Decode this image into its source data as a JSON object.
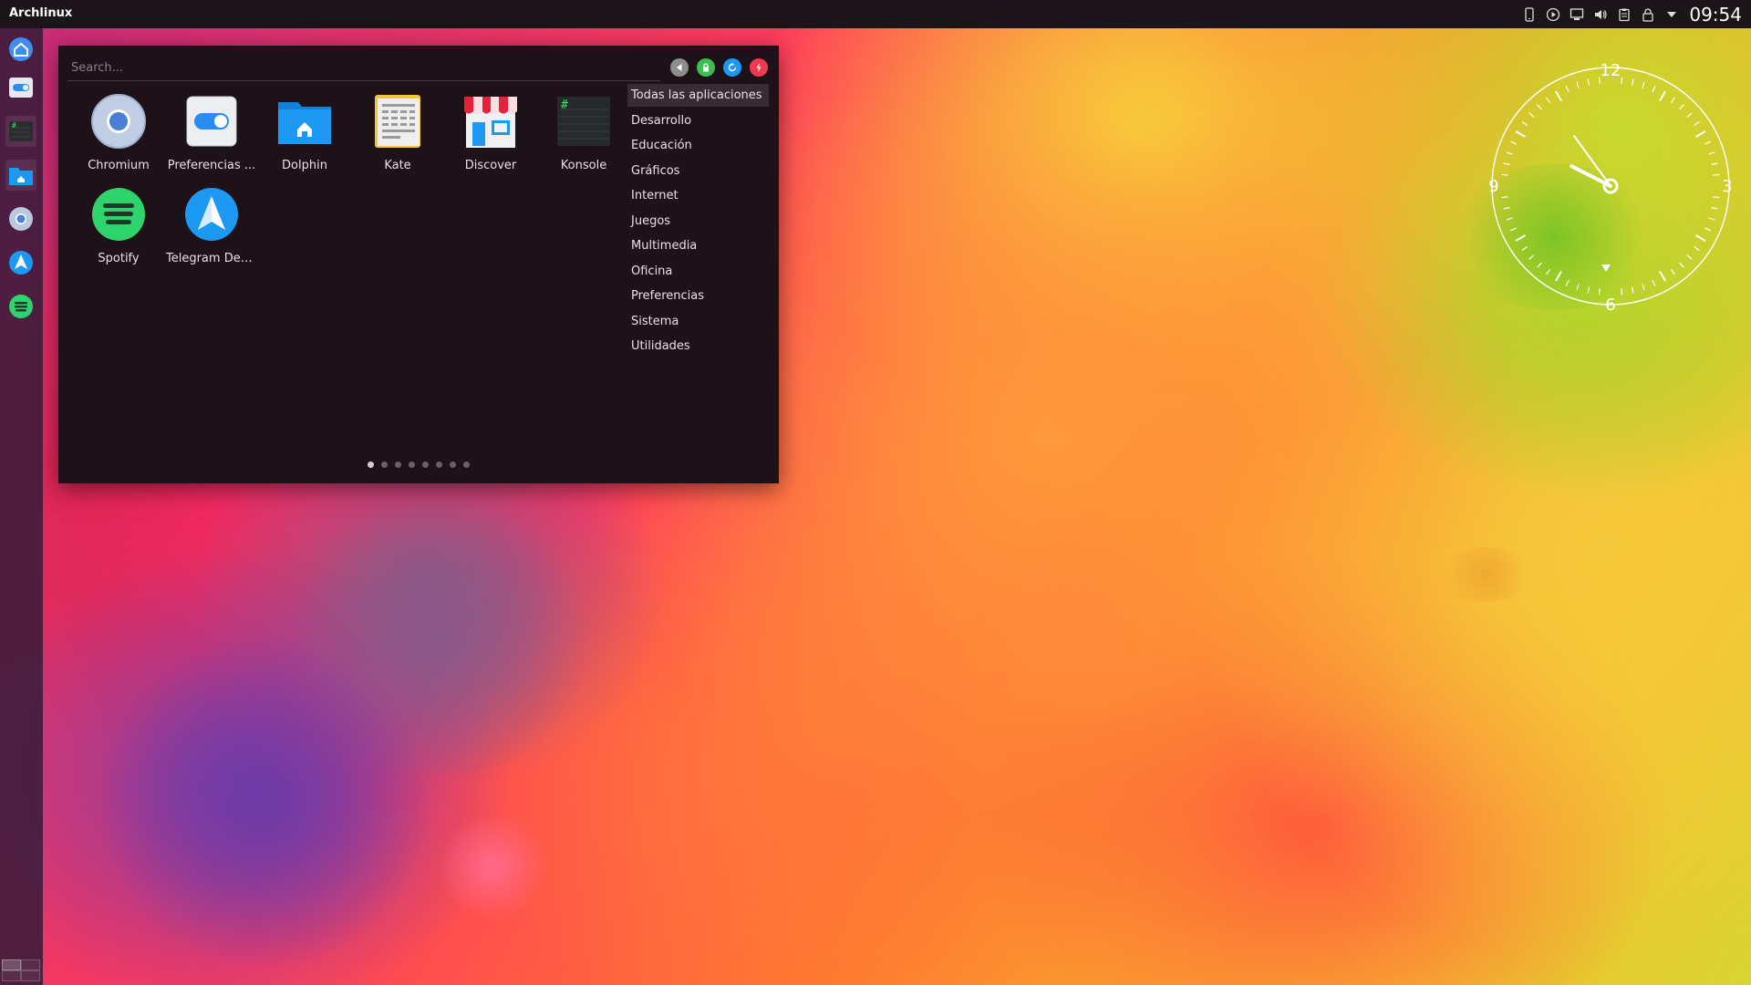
{
  "top_panel": {
    "app_name": "Archlinux",
    "clock": "09:54",
    "tray_icons": [
      "phone-icon",
      "media-play-icon",
      "network-icon",
      "volume-icon",
      "clipboard-icon",
      "lock-icon",
      "expand-arrow-icon"
    ]
  },
  "dock": {
    "items": [
      {
        "name": "home-icon",
        "active": false
      },
      {
        "name": "settings-toggle-icon",
        "active": false
      },
      {
        "name": "terminal-icon",
        "active": true
      },
      {
        "name": "folder-icon",
        "active": true
      },
      {
        "name": "chromium-icon",
        "active": false
      },
      {
        "name": "telegram-icon",
        "active": false
      },
      {
        "name": "spotify-icon",
        "active": false
      }
    ]
  },
  "launcher": {
    "search_placeholder": "Search...",
    "session_buttons": [
      "back-icon",
      "lock-icon",
      "refresh-icon",
      "power-icon"
    ],
    "apps": [
      {
        "label": "Chromium",
        "icon": "chromium-icon"
      },
      {
        "label": "Preferencias ...",
        "icon": "preferences-icon"
      },
      {
        "label": "Dolphin",
        "icon": "dolphin-folder-icon"
      },
      {
        "label": "Kate",
        "icon": "kate-editor-icon"
      },
      {
        "label": "Discover",
        "icon": "discover-store-icon"
      },
      {
        "label": "Konsole",
        "icon": "konsole-icon"
      },
      {
        "label": "Spotify",
        "icon": "spotify-icon"
      },
      {
        "label": "Telegram Des...",
        "icon": "telegram-icon"
      }
    ],
    "categories": [
      "Todas las aplicaciones",
      "Desarrollo",
      "Educación",
      "Gráficos",
      "Internet",
      "Juegos",
      "Multimedia",
      "Oficina",
      "Preferencias",
      "Sistema",
      "Utilidades"
    ],
    "selected_category": "Todas las aplicaciones",
    "page_count": 8,
    "current_page": 1
  },
  "clock_widget": {
    "numerals": [
      "12",
      "3",
      "6",
      "9"
    ],
    "hour": 9,
    "minute": 54
  },
  "colors": {
    "launcher_bg": "#1e1219",
    "panel_bg": "#1b1418",
    "accent_blue": "#1d99f3"
  }
}
